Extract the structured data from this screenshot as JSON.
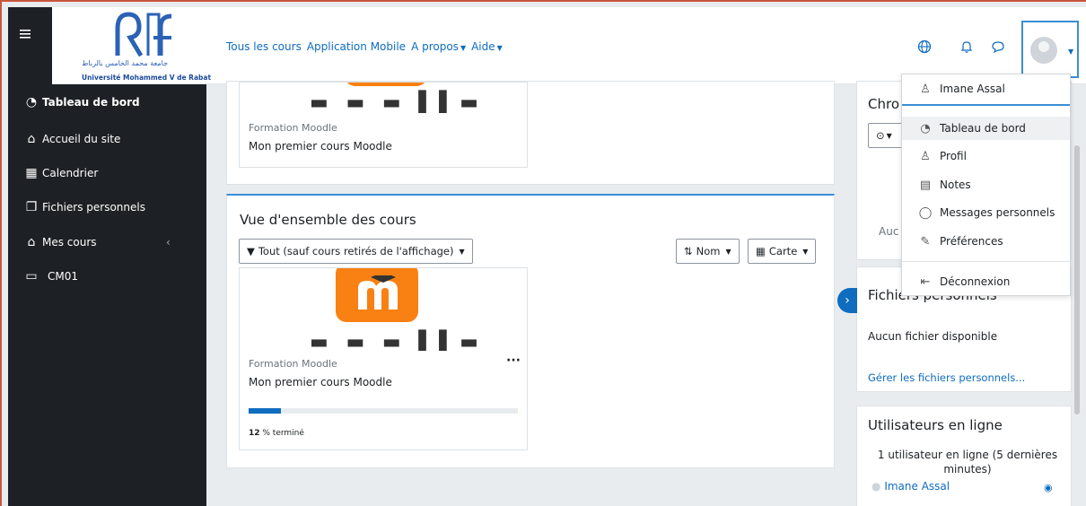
{
  "header": {
    "logo_arabic": "جامعة محمد الخامس بالرباط",
    "logo_name": "Université Mohammed V de Rabat",
    "nav_links": [
      {
        "label": "Tous les cours"
      },
      {
        "label": "Application Mobile"
      },
      {
        "label": "A propos"
      },
      {
        "label": "Aide"
      }
    ],
    "icons": [
      "globe-icon",
      "bell-icon",
      "chat-icon",
      "avatar-icon"
    ]
  },
  "sidebar": {
    "items": [
      {
        "label": "Tableau de bord",
        "icon": "dashboard-icon"
      },
      {
        "label": "Accueil du site",
        "icon": "home-icon"
      },
      {
        "label": "Calendrier",
        "icon": "calendar-icon"
      },
      {
        "label": "Fichiers personnels",
        "icon": "files-icon"
      },
      {
        "label": "Mes cours",
        "icon": "graduation-cap-icon"
      },
      {
        "label": "CM01",
        "icon": "folder-icon"
      }
    ]
  },
  "recent_course": {
    "category": "Formation Moodle",
    "name": "Mon premier cours Moodle"
  },
  "overview": {
    "title": "Vue d'ensemble des cours",
    "filter_label": "Tout (sauf cours retirés de l'affichage)",
    "sort_label": "Nom",
    "view_label": "Carte",
    "course": {
      "category": "Formation Moodle",
      "name": "Mon premier cours Moodle",
      "progress_percent": 12,
      "progress_number": "12",
      "progress_suffix": " % terminé"
    }
  },
  "drawer": {
    "timeline_title_partial": "Chro",
    "timeline_empty_partial": "Auc",
    "files_title": "Fichiers personnels",
    "files_empty": "Aucun fichier disponible",
    "files_link": "Gérer les fichiers personnels...",
    "online_title": "Utilisateurs en ligne",
    "online_text": "1 utilisateur en ligne (5 dernières minutes)",
    "online_user": "Imane Assal"
  },
  "user_menu": {
    "user_name": "Imane Assal",
    "items": [
      {
        "label": "Tableau de bord",
        "icon": "dashboard-icon"
      },
      {
        "label": "Profil",
        "icon": "user-icon"
      },
      {
        "label": "Notes",
        "icon": "grades-icon"
      },
      {
        "label": "Messages personnels",
        "icon": "chat-icon"
      },
      {
        "label": "Préférences",
        "icon": "wrench-icon"
      }
    ],
    "logout": "Déconnexion"
  },
  "colors": {
    "brand_blue": "#0f6cbf",
    "sidebar_dark": "#1d2125",
    "moodle_orange": "#f98012"
  }
}
